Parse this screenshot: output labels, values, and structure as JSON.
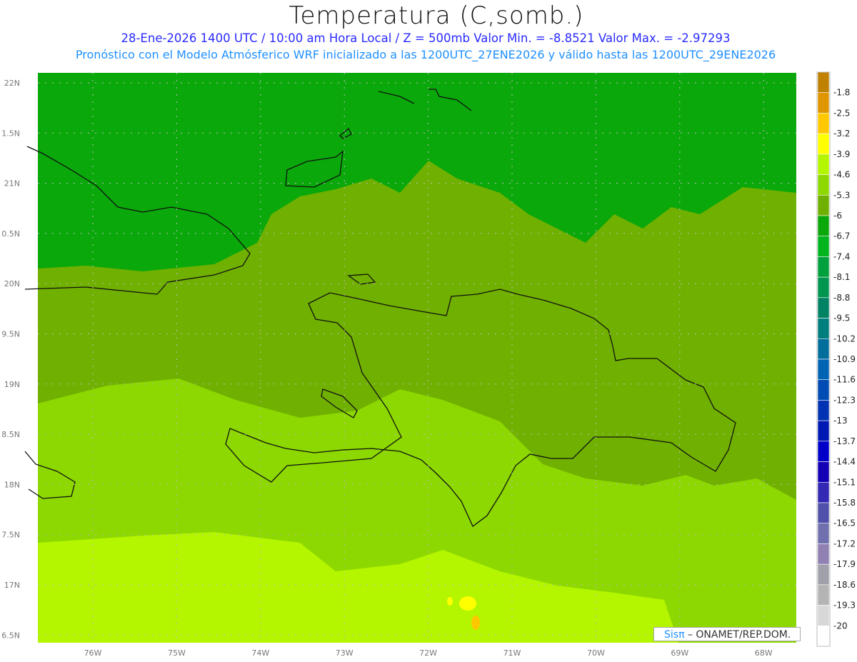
{
  "title": "Temperatura (C,somb.)",
  "subtitle_line1": "28-Ene-2026  1400 UTC / 10:00 am Hora Local / Z = 500mb  Valor Min. = -8.8521  Valor Max. = -2.97293",
  "subtitle_line2": "Pronóstico con el Modelo Atmósferico WRF inicializado a las 1200UTC_27ENE2026 y válido hasta las  1200UTC_29ENE2026",
  "map": {
    "lon_ticks": [
      "76W",
      "75W",
      "74W",
      "73W",
      "72W",
      "71W",
      "70W",
      "69W",
      "68W"
    ],
    "lat_ticks": [
      "22N",
      "1.5N",
      "21N",
      "0.5N",
      "20N",
      "9.5N",
      "19N",
      "8.5N",
      "18N",
      "7.5N",
      "17N",
      "6.5N"
    ],
    "field_colors": {
      "-6.7": "#0aa80a",
      "-6": "#70b000",
      "-5.3": "#8cd800",
      "-4.6": "#b4f500",
      "-3.9": "#ffff00",
      "-3.2": "#ffc800"
    }
  },
  "colorbar": {
    "labels": [
      "-1.8",
      "-2.5",
      "-3.2",
      "-3.9",
      "-4.6",
      "-5.3",
      "-6",
      "-6.7",
      "-7.4",
      "-8.1",
      "-8.8",
      "-9.5",
      "-10.2",
      "-10.9",
      "-11.6",
      "-12.3",
      "-13",
      "-13.7",
      "-14.4",
      "-15.1",
      "-15.8",
      "-16.5",
      "-17.2",
      "-17.9",
      "-18.6",
      "-19.3",
      "-20"
    ],
    "colors": [
      "#c08000",
      "#e09600",
      "#ffc800",
      "#ffff00",
      "#b4f500",
      "#8cd800",
      "#70b000",
      "#0aa80a",
      "#00b41e",
      "#00a03c",
      "#009650",
      "#008264",
      "#007d7d",
      "#006e9b",
      "#0064b4",
      "#004bb4",
      "#0032b4",
      "#0019b4",
      "#0000c8",
      "#1400b4",
      "#3228b4",
      "#5050aa",
      "#7070af",
      "#9080b4",
      "#a0a0aa",
      "#b4b4b4",
      "#d8d8d8",
      "#ffffff"
    ]
  },
  "logo": {
    "sis": "Sisπ",
    "text": "– ONAMET/REP.DOM."
  }
}
